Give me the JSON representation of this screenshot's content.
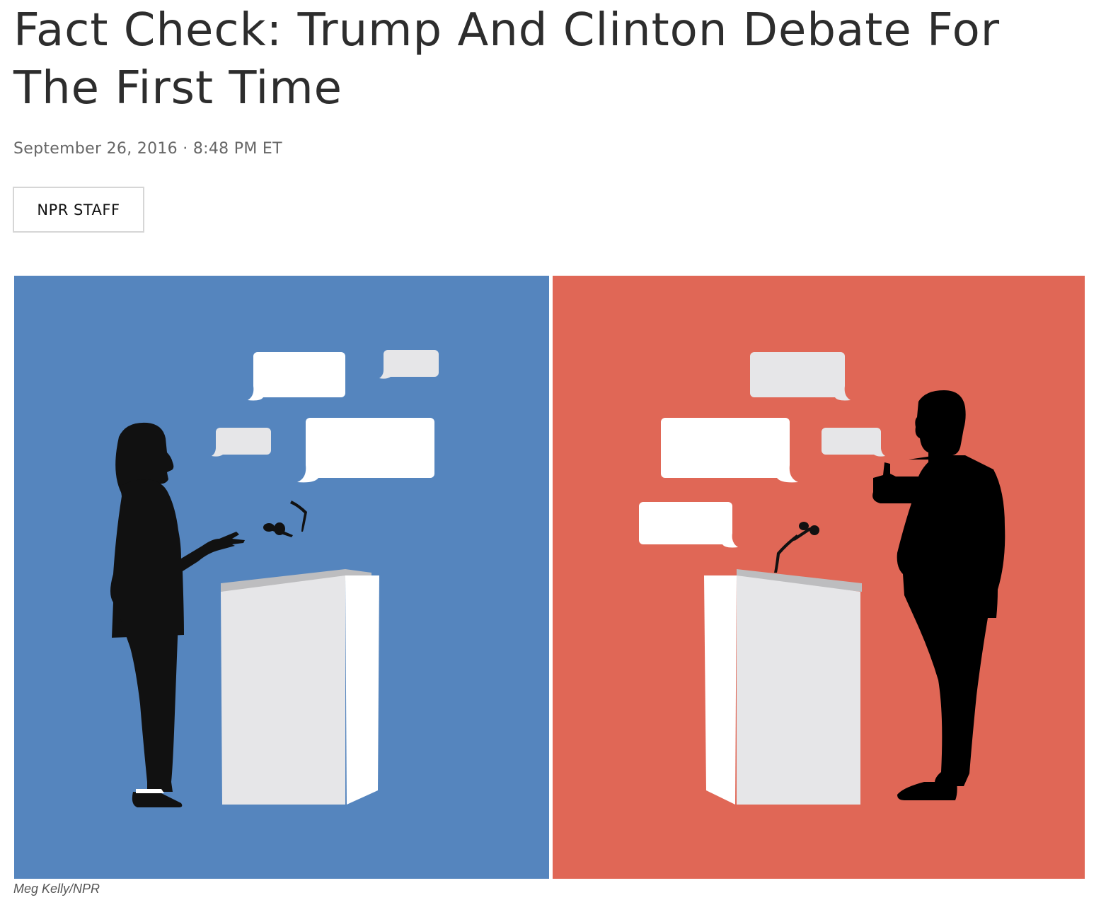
{
  "article": {
    "headline": "Fact Check: Trump And Clinton Debate For The First Time",
    "date": "September 26, 2016",
    "separator": "·",
    "time": "8:48 PM ET",
    "byline": "NPR STAFF"
  },
  "image": {
    "credit": "Meg Kelly/NPR",
    "left_panel_color": "#5585be",
    "right_panel_color": "#e06756",
    "bubble_color_white": "#ffffff",
    "bubble_color_gray": "#e6e6e8",
    "silhouette_color": "#111111"
  }
}
